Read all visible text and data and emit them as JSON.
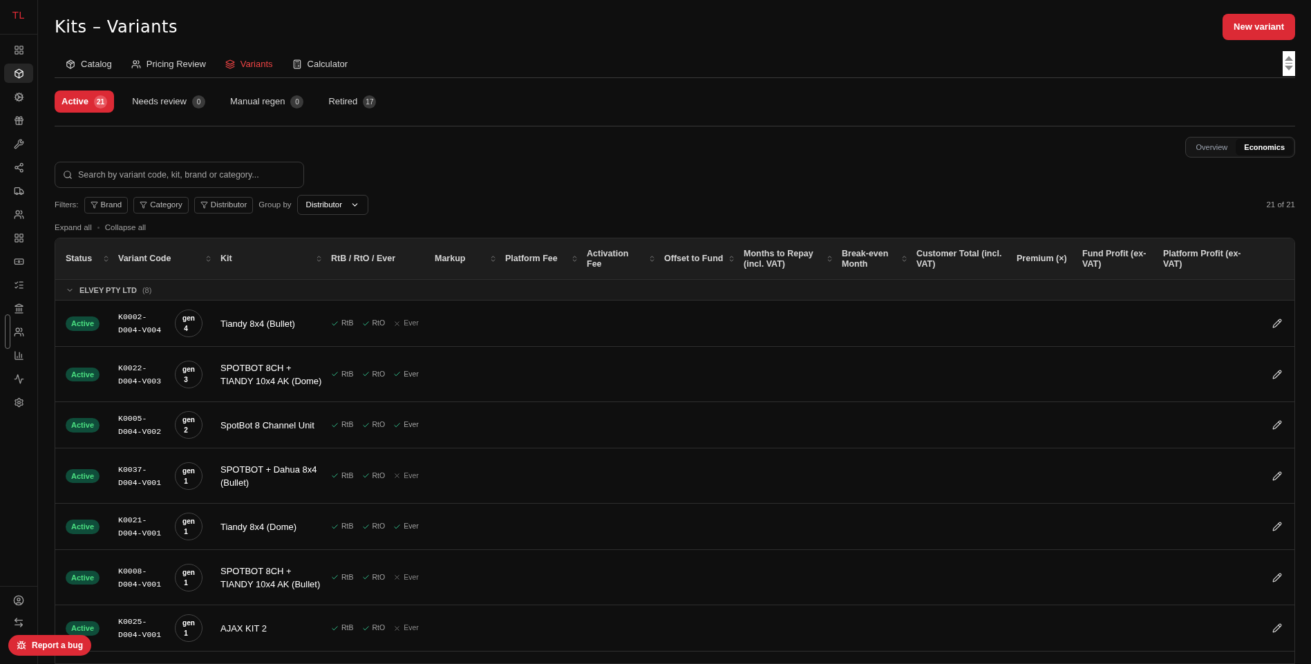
{
  "sidebar": {
    "logo": "TL",
    "items": [
      {
        "selected": false
      },
      {
        "selected": true
      },
      {
        "selected": false
      },
      {
        "selected": false
      },
      {
        "selected": false
      },
      {
        "selected": false
      },
      {
        "selected": false
      },
      {
        "selected": false
      },
      {
        "selected": false
      },
      {
        "selected": false
      },
      {
        "selected": false
      },
      {
        "selected": false
      },
      {
        "selected": false
      },
      {
        "selected": false
      },
      {
        "selected": false
      },
      {
        "selected": false
      }
    ],
    "report_bug": "Report a bug"
  },
  "page": {
    "title": "Kits – Variants",
    "new_button": "New variant"
  },
  "tabs": [
    {
      "label": "Catalog",
      "selected": false
    },
    {
      "label": "Pricing Review",
      "selected": false
    },
    {
      "label": "Variants",
      "selected": true
    },
    {
      "label": "Calculator",
      "selected": false
    }
  ],
  "status_tabs": [
    {
      "label": "Active",
      "count": "21",
      "selected": true
    },
    {
      "label": "Needs review",
      "count": "0",
      "selected": false
    },
    {
      "label": "Manual regen",
      "count": "0",
      "selected": false
    },
    {
      "label": "Retired",
      "count": "17",
      "selected": false
    }
  ],
  "view_toggle": [
    {
      "label": "Overview",
      "selected": false
    },
    {
      "label": "Economics",
      "selected": true
    }
  ],
  "search": {
    "placeholder": "Search by variant code, kit, brand or category..."
  },
  "filters": {
    "label": "Filters:",
    "chips": [
      "Brand",
      "Category",
      "Distributor"
    ],
    "group_by_label": "Group by",
    "group_by_value": "Distributor",
    "count": "21 of 21"
  },
  "expand_all": "Expand all",
  "collapse_all": "Collapse all",
  "table": {
    "columns": [
      {
        "label": "Status",
        "sortable": true
      },
      {
        "label": "Variant Code",
        "sortable": true
      },
      {
        "label": "Kit",
        "sortable": true
      },
      {
        "label": "RtB / RtO / Ever",
        "sortable": false
      },
      {
        "label": "Markup",
        "sortable": true
      },
      {
        "label": "Platform Fee",
        "sortable": true
      },
      {
        "label": "Activation Fee",
        "sortable": true
      },
      {
        "label": "Offset to Fund",
        "sortable": true
      },
      {
        "label": "Months to Repay (incl. VAT)",
        "sortable": true
      },
      {
        "label": "Break-even Month",
        "sortable": true
      },
      {
        "label": "Customer Total (incl. VAT)",
        "sortable": false
      },
      {
        "label": "Premium (×)",
        "sortable": false
      },
      {
        "label": "Fund Profit (ex-VAT)",
        "sortable": false
      },
      {
        "label": "Platform Profit (ex-VAT)",
        "sortable": false
      }
    ],
    "group": {
      "name": "ELVEY PTY LTD",
      "count": "(8)",
      "expanded": true
    },
    "rows": [
      {
        "status": "Active",
        "code": "K0002-D004-V004",
        "gen_label": "gen",
        "gen": "4",
        "kit": "Tiandy 8x4 (Bullet)",
        "flags": [
          {
            "label": "RtB",
            "on": true
          },
          {
            "label": "RtO",
            "on": true
          },
          {
            "label": "Ever",
            "on": false
          }
        ]
      },
      {
        "status": "Active",
        "code": "K0022-D004-V003",
        "gen_label": "gen",
        "gen": "3",
        "kit": "SPOTBOT 8CH + TIANDY 10x4 AK (Dome)",
        "flags": [
          {
            "label": "RtB",
            "on": true
          },
          {
            "label": "RtO",
            "on": true
          },
          {
            "label": "Ever",
            "on": true
          }
        ]
      },
      {
        "status": "Active",
        "code": "K0005-D004-V002",
        "gen_label": "gen",
        "gen": "2",
        "kit": "SpotBot 8 Channel Unit",
        "flags": [
          {
            "label": "RtB",
            "on": true
          },
          {
            "label": "RtO",
            "on": true
          },
          {
            "label": "Ever",
            "on": true
          }
        ]
      },
      {
        "status": "Active",
        "code": "K0037-D004-V001",
        "gen_label": "gen",
        "gen": "1",
        "kit": "SPOTBOT + Dahua 8x4 (Bullet)",
        "flags": [
          {
            "label": "RtB",
            "on": true
          },
          {
            "label": "RtO",
            "on": true
          },
          {
            "label": "Ever",
            "on": false
          }
        ]
      },
      {
        "status": "Active",
        "code": "K0021-D004-V001",
        "gen_label": "gen",
        "gen": "1",
        "kit": "Tiandy 8x4 (Dome)",
        "flags": [
          {
            "label": "RtB",
            "on": true
          },
          {
            "label": "RtO",
            "on": true
          },
          {
            "label": "Ever",
            "on": true
          }
        ]
      },
      {
        "status": "Active",
        "code": "K0008-D004-V001",
        "gen_label": "gen",
        "gen": "1",
        "kit": "SPOTBOT 8CH + TIANDY 10x4 AK (Bullet)",
        "flags": [
          {
            "label": "RtB",
            "on": true
          },
          {
            "label": "RtO",
            "on": true
          },
          {
            "label": "Ever",
            "on": false
          }
        ]
      },
      {
        "status": "Active",
        "code": "K0025-D004-V001",
        "gen_label": "gen",
        "gen": "1",
        "kit": "AJAX KIT 2",
        "flags": [
          {
            "label": "RtB",
            "on": true
          },
          {
            "label": "RtO",
            "on": true
          },
          {
            "label": "Ever",
            "on": false
          }
        ]
      }
    ]
  }
}
